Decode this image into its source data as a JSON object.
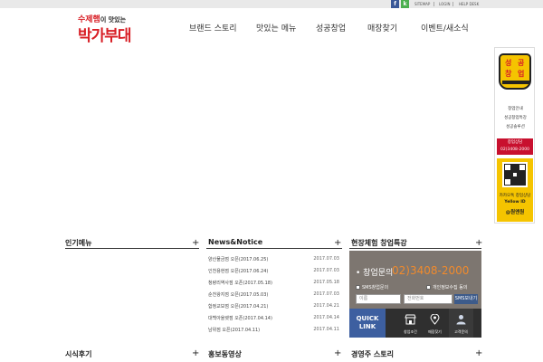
{
  "topbar": {
    "facebook": "f",
    "kakao": "k",
    "links": [
      "SITEMAP",
      "LOGIN",
      "HELP DESK"
    ]
  },
  "logo": {
    "line1_part1": "수제햄",
    "line1_part2": "이 맛있는",
    "line2": "박가부대"
  },
  "nav": {
    "items": [
      "브랜드 스토리",
      "맛있는 메뉴",
      "성공창업",
      "매장찾기",
      "이벤트/새소식"
    ]
  },
  "side_banner": {
    "seal": [
      "성",
      "공",
      "창",
      "업"
    ],
    "links": [
      "창업안내",
      "성공창업특강",
      "성공솔루션"
    ],
    "call_label": "창업상담",
    "call_number": "02)3408-2000",
    "kakao_label": "카카오톡 창업상담",
    "yellow_id_label": "Yellow ID",
    "yellow_id": "@원앤원"
  },
  "sections": {
    "popular_menu": "인기메뉴",
    "news_notice": "News&Notice",
    "seminar": "현장체험 창업특강",
    "reviews": "시식후기",
    "promo_video": "홍보동영상",
    "owner_story": "경영주 스토리"
  },
  "news": [
    {
      "title": "양산물금점 오픈(2017.06.25)",
      "date": "2017.07.03"
    },
    {
      "title": "인천용현점 오픈(2017.06.24)",
      "date": "2017.07.03"
    },
    {
      "title": "청량리역사점 오픈(2017.05.18)",
      "date": "2017.05.18"
    },
    {
      "title": "순천왕지점 오픈(2017.05.03)",
      "date": "2017.07.03"
    },
    {
      "title": "합정교보점 오픈(2017.04.21)",
      "date": "2017.04.21"
    },
    {
      "title": "대백아울렛점 오픈(2017.04.14)",
      "date": "2017.04.14"
    },
    {
      "title": "남위점 오픈(2017.04.11)",
      "date": "2017.04.11"
    }
  ],
  "consult": {
    "label": "창업문의",
    "number": "02)3408-2000",
    "sms_opt": "SMS창업문의",
    "privacy_opt": "개인정보수집 동의",
    "name_placeholder": "이름",
    "phone_placeholder": "전화번호",
    "send_label": "SMS보내기"
  },
  "quicklink": {
    "label_line1": "QUICK",
    "label_line2": "LINK",
    "items": [
      "창업조건",
      "매장찾기",
      "고객문의"
    ]
  },
  "colors": {
    "brand_red": "#d81f26",
    "quick_blue": "#3d5fa0",
    "phone_orange": "#f08a2c",
    "seal_yellow": "#f5c400"
  }
}
